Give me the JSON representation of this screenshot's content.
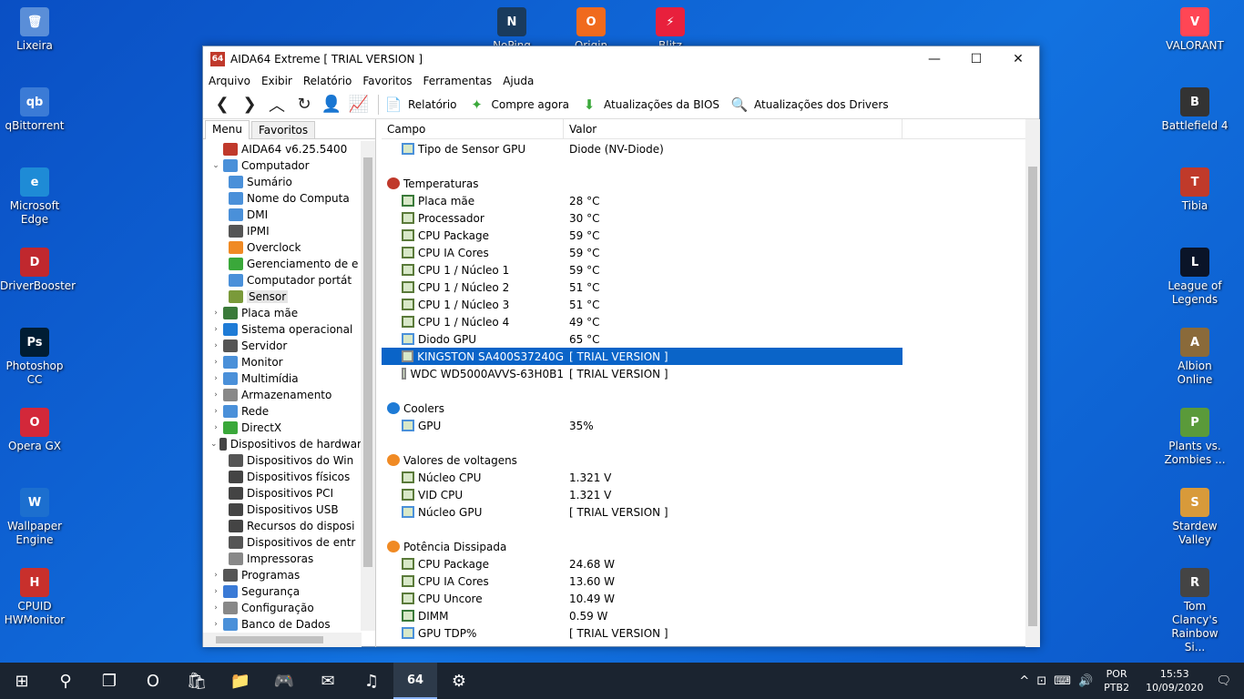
{
  "desktop": {
    "left_icons": [
      {
        "label": "Lixeira",
        "color": "#5a8ed8",
        "glyph": "🗑"
      },
      {
        "label": "qBittorrent",
        "color": "#3b7bd6",
        "glyph": "qb"
      },
      {
        "label": "Microsoft Edge",
        "color": "#1e8bd6",
        "glyph": "e"
      },
      {
        "label": "DriverBooster",
        "color": "#c0282e",
        "glyph": "D"
      },
      {
        "label": "Photoshop CC",
        "color": "#001d34",
        "glyph": "Ps"
      },
      {
        "label": "Opera GX",
        "color": "#d3283a",
        "glyph": "O"
      },
      {
        "label": "Wallpaper Engine",
        "color": "#1c6fcf",
        "glyph": "W"
      },
      {
        "label": "CPUID HWMonitor",
        "color": "#c8302c",
        "glyph": "H"
      }
    ],
    "top_icons": [
      {
        "label": "NoPing",
        "color": "#1a3b5d",
        "glyph": "N"
      },
      {
        "label": "Origin",
        "color": "#f06a1d",
        "glyph": "O"
      },
      {
        "label": "Blitz",
        "color": "#e8203c",
        "glyph": "⚡"
      }
    ],
    "right_icons": [
      {
        "label": "VALORANT",
        "color": "#ff4655",
        "glyph": "V"
      },
      {
        "label": "Battlefield 4",
        "color": "#333333",
        "glyph": "B"
      },
      {
        "label": "Tibia",
        "color": "#c03a2a",
        "glyph": "T"
      },
      {
        "label": "League of Legends",
        "color": "#0a1428",
        "glyph": "L"
      },
      {
        "label": "Albion Online",
        "color": "#8a6a3a",
        "glyph": "A"
      },
      {
        "label": "Plants vs. Zombies ...",
        "color": "#5a9a3a",
        "glyph": "P"
      },
      {
        "label": "Stardew Valley",
        "color": "#d89a3a",
        "glyph": "S"
      },
      {
        "label": "Tom Clancy's Rainbow Si...",
        "color": "#444444",
        "glyph": "R"
      }
    ]
  },
  "window": {
    "logo": "64",
    "title": "AIDA64 Extreme  [ TRIAL VERSION ]",
    "controls": {
      "min": "—",
      "max": "☐",
      "close": "✕"
    }
  },
  "menu": [
    "Arquivo",
    "Exibir",
    "Relatório",
    "Favoritos",
    "Ferramentas",
    "Ajuda"
  ],
  "toolbar": {
    "nav_glyphs": [
      "❮",
      "❯",
      "︿",
      "↻",
      "👤",
      "📈"
    ],
    "report": "Relatório",
    "buy": "Compre agora",
    "bios": "Atualizações da BIOS",
    "drivers": "Atualizações dos Drivers"
  },
  "tabs": {
    "menu": "Menu",
    "favorites": "Favoritos"
  },
  "tree": [
    {
      "level": 0,
      "exp": "",
      "label": "AIDA64 v6.25.5400",
      "color": "#c0392b"
    },
    {
      "level": 0,
      "exp": "⌄",
      "label": "Computador",
      "color": "#4a90d9"
    },
    {
      "level": 1,
      "exp": "",
      "label": "Sumário",
      "color": "#4a90d9"
    },
    {
      "level": 1,
      "exp": "",
      "label": "Nome do Computa",
      "color": "#4a90d9"
    },
    {
      "level": 1,
      "exp": "",
      "label": "DMI",
      "color": "#4a90d9"
    },
    {
      "level": 1,
      "exp": "",
      "label": "IPMI",
      "color": "#555555"
    },
    {
      "level": 1,
      "exp": "",
      "label": "Overclock",
      "color": "#f08a24"
    },
    {
      "level": 1,
      "exp": "",
      "label": "Gerenciamento de e",
      "color": "#3aa83a"
    },
    {
      "level": 1,
      "exp": "",
      "label": "Computador portát",
      "color": "#4a90d9"
    },
    {
      "level": 1,
      "exp": "",
      "label": "Sensor",
      "color": "#7a9a3a",
      "sel": true
    },
    {
      "level": 0,
      "exp": "›",
      "label": "Placa mãe",
      "color": "#3a7a3a"
    },
    {
      "level": 0,
      "exp": "›",
      "label": "Sistema operacional",
      "color": "#1e7bd6"
    },
    {
      "level": 0,
      "exp": "›",
      "label": "Servidor",
      "color": "#555555"
    },
    {
      "level": 0,
      "exp": "›",
      "label": "Monitor",
      "color": "#4a90d9"
    },
    {
      "level": 0,
      "exp": "›",
      "label": "Multimídia",
      "color": "#4a90d9"
    },
    {
      "level": 0,
      "exp": "›",
      "label": "Armazenamento",
      "color": "#888888"
    },
    {
      "level": 0,
      "exp": "›",
      "label": "Rede",
      "color": "#4a90d9"
    },
    {
      "level": 0,
      "exp": "›",
      "label": "DirectX",
      "color": "#3aa83a"
    },
    {
      "level": 0,
      "exp": "⌄",
      "label": "Dispositivos de hardwar",
      "color": "#444444"
    },
    {
      "level": 1,
      "exp": "",
      "label": "Dispositivos do Win",
      "color": "#555555"
    },
    {
      "level": 1,
      "exp": "",
      "label": "Dispositivos físicos",
      "color": "#444444"
    },
    {
      "level": 1,
      "exp": "",
      "label": "Dispositivos PCI",
      "color": "#444444"
    },
    {
      "level": 1,
      "exp": "",
      "label": "Dispositivos USB",
      "color": "#444444"
    },
    {
      "level": 1,
      "exp": "",
      "label": "Recursos do disposi",
      "color": "#444444"
    },
    {
      "level": 1,
      "exp": "",
      "label": "Dispositivos de entr",
      "color": "#555555"
    },
    {
      "level": 1,
      "exp": "",
      "label": "Impressoras",
      "color": "#888888"
    },
    {
      "level": 0,
      "exp": "›",
      "label": "Programas",
      "color": "#555555"
    },
    {
      "level": 0,
      "exp": "›",
      "label": "Segurança",
      "color": "#3a7ad6"
    },
    {
      "level": 0,
      "exp": "›",
      "label": "Configuração",
      "color": "#888888"
    },
    {
      "level": 0,
      "exp": "›",
      "label": "Banco de Dados",
      "color": "#4a90d9"
    }
  ],
  "columns": {
    "field": "Campo",
    "value": "Valor"
  },
  "rows": [
    {
      "type": "item",
      "field": "Tipo de Sensor GPU",
      "value": "Diode  (NV-Diode)",
      "color": "#4a90d9"
    },
    {
      "type": "spacer"
    },
    {
      "type": "group",
      "field": "Temperaturas",
      "color": "#c0392b"
    },
    {
      "type": "item",
      "field": "Placa mãe",
      "value": "28 °C",
      "color": "#3a7a3a"
    },
    {
      "type": "item",
      "field": "Processador",
      "value": "30 °C",
      "color": "#5a7a3a"
    },
    {
      "type": "item",
      "field": "CPU Package",
      "value": "59 °C",
      "color": "#5a7a3a"
    },
    {
      "type": "item",
      "field": "CPU IA Cores",
      "value": "59 °C",
      "color": "#5a7a3a"
    },
    {
      "type": "item",
      "field": "CPU 1 / Núcleo 1",
      "value": "59 °C",
      "color": "#5a7a3a"
    },
    {
      "type": "item",
      "field": "CPU 1 / Núcleo 2",
      "value": "51 °C",
      "color": "#5a7a3a"
    },
    {
      "type": "item",
      "field": "CPU 1 / Núcleo 3",
      "value": "51 °C",
      "color": "#5a7a3a"
    },
    {
      "type": "item",
      "field": "CPU 1 / Núcleo 4",
      "value": "49 °C",
      "color": "#5a7a3a"
    },
    {
      "type": "item",
      "field": "Diodo GPU",
      "value": "65 °C",
      "color": "#4a90d9"
    },
    {
      "type": "item",
      "field": "KINGSTON SA400S37240G",
      "value": "[ TRIAL VERSION ]",
      "color": "#888888",
      "sel": true
    },
    {
      "type": "item",
      "field": "WDC WD5000AVVS-63H0B1",
      "value": "[ TRIAL VERSION ]",
      "color": "#888888"
    },
    {
      "type": "spacer"
    },
    {
      "type": "group",
      "field": "Coolers",
      "color": "#1e7bd6"
    },
    {
      "type": "item",
      "field": "GPU",
      "value": "35%",
      "color": "#4a90d9"
    },
    {
      "type": "spacer"
    },
    {
      "type": "group",
      "field": "Valores de voltagens",
      "color": "#f08a24"
    },
    {
      "type": "item",
      "field": "Núcleo CPU",
      "value": "1.321 V",
      "color": "#5a7a3a"
    },
    {
      "type": "item",
      "field": "VID CPU",
      "value": "1.321 V",
      "color": "#5a7a3a"
    },
    {
      "type": "item",
      "field": "Núcleo GPU",
      "value": "[ TRIAL VERSION ]",
      "color": "#4a90d9"
    },
    {
      "type": "spacer"
    },
    {
      "type": "group",
      "field": "Potência Dissipada",
      "color": "#f08a24"
    },
    {
      "type": "item",
      "field": "CPU Package",
      "value": "24.68 W",
      "color": "#5a7a3a"
    },
    {
      "type": "item",
      "field": "CPU IA Cores",
      "value": "13.60 W",
      "color": "#5a7a3a"
    },
    {
      "type": "item",
      "field": "CPU Uncore",
      "value": "10.49 W",
      "color": "#5a7a3a"
    },
    {
      "type": "item",
      "field": "DIMM",
      "value": "0.59 W",
      "color": "#3a7a3a"
    },
    {
      "type": "item",
      "field": "GPU TDP%",
      "value": "[ TRIAL VERSION ]",
      "color": "#4a90d9"
    }
  ],
  "taskbar": {
    "apps": [
      {
        "name": "start",
        "glyph": "⊞"
      },
      {
        "name": "search",
        "glyph": "⚲"
      },
      {
        "name": "task-view",
        "glyph": "❐"
      },
      {
        "name": "opera",
        "glyph": "O"
      },
      {
        "name": "store",
        "glyph": "🛍"
      },
      {
        "name": "explorer",
        "glyph": "📁"
      },
      {
        "name": "discord",
        "glyph": "🎮"
      },
      {
        "name": "mail",
        "glyph": "✉"
      },
      {
        "name": "spotify",
        "glyph": "♫"
      },
      {
        "name": "aida64",
        "glyph": "64",
        "active": true
      },
      {
        "name": "settings",
        "glyph": "⚙"
      }
    ],
    "tray_glyphs": [
      "^",
      "⊡",
      "⌨",
      "🔊"
    ],
    "lang1": "POR",
    "lang2": "PTB2",
    "time": "15:53",
    "date": "10/09/2020",
    "notify_glyph": "🗨"
  }
}
